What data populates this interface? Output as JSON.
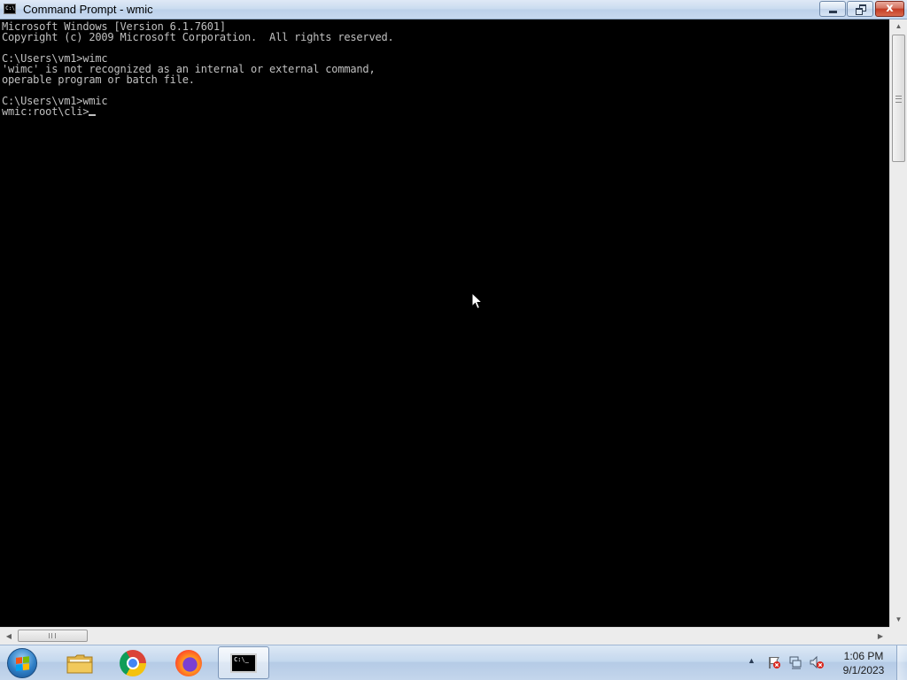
{
  "window": {
    "title": "Command Prompt - wmic",
    "close_glyph": "x"
  },
  "console": {
    "lines": [
      "Microsoft Windows [Version 6.1.7601]",
      "Copyright (c) 2009 Microsoft Corporation.  All rights reserved.",
      "",
      "C:\\Users\\vm1>wimc",
      "'wimc' is not recognized as an internal or external command,",
      "operable program or batch file.",
      "",
      "C:\\Users\\vm1>wmic",
      "wmic:root\\cli>"
    ],
    "text_color": "#c0c0c0",
    "background": "#000000"
  },
  "icons": {
    "app_icon_text": "C:\\",
    "cmd_taskbar_text": "C:\\_"
  },
  "taskbar": {
    "pinned": [
      {
        "name": "Windows Explorer",
        "icon": "folder-icon"
      },
      {
        "name": "Google Chrome",
        "icon": "chrome-icon"
      },
      {
        "name": "Mozilla Firefox",
        "icon": "firefox-icon"
      },
      {
        "name": "Command Prompt",
        "icon": "cmd-icon",
        "active": true
      }
    ]
  },
  "tray": {
    "arrow": "▲",
    "time": "1:06 PM",
    "date": "9/1/2023"
  }
}
